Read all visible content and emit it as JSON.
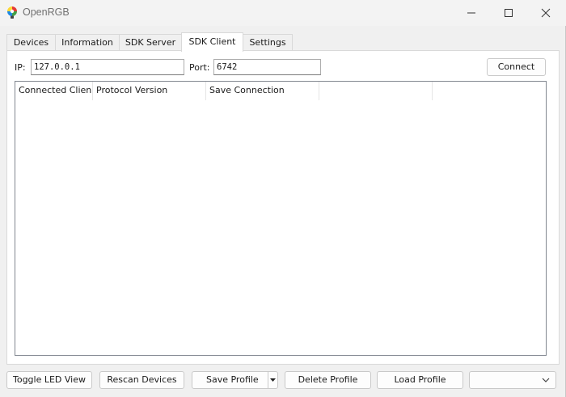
{
  "window": {
    "title": "OpenRGB"
  },
  "tabs": [
    {
      "label": "Devices"
    },
    {
      "label": "Information"
    },
    {
      "label": "SDK Server"
    },
    {
      "label": "SDK Client",
      "active": true
    },
    {
      "label": "Settings"
    }
  ],
  "connection": {
    "ip_label": "IP:",
    "ip_value": "127.0.0.1",
    "port_label": "Port:",
    "port_value": "6742",
    "connect_label": "Connect"
  },
  "table": {
    "columns": [
      "Connected Clien",
      "Protocol Version",
      "Save Connection",
      "",
      ""
    ]
  },
  "bottom_bar": {
    "toggle_led_view": "Toggle LED View",
    "rescan_devices": "Rescan Devices",
    "save_profile": "Save Profile",
    "delete_profile": "Delete Profile",
    "load_profile": "Load Profile",
    "profile_select_value": ""
  },
  "icons": {
    "app": "openrgb-logo-icon",
    "minimize": "minimize-icon",
    "maximize": "maximize-icon",
    "close": "close-icon",
    "dropdown": "chevron-down-icon",
    "split": "triangle-down-icon"
  }
}
